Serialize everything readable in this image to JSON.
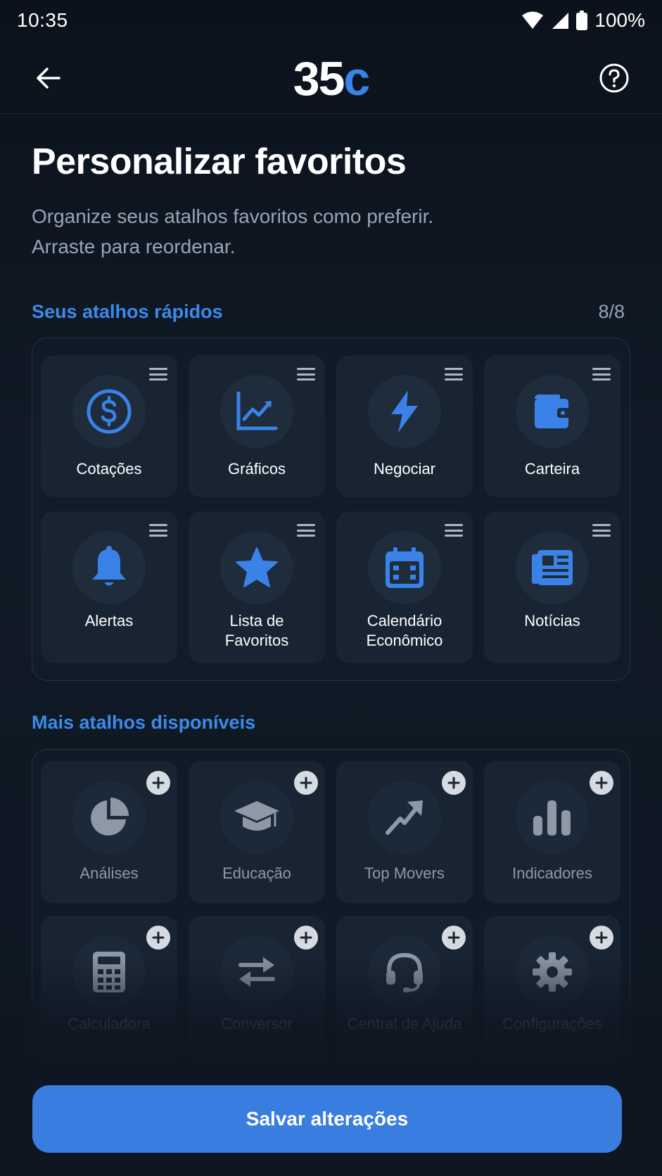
{
  "status_bar": {
    "time": "10:35",
    "battery": "100%"
  },
  "app_bar": {
    "logo_number": "35",
    "logo_letter": "c"
  },
  "page": {
    "title": "Personalizar favoritos",
    "subtitle_line1": "Organize seus atalhos favoritos como preferir.",
    "subtitle_line2": "Arraste para reordenar."
  },
  "quick": {
    "label": "Seus atalhos rápidos",
    "count": "8/8",
    "items": [
      {
        "label1": "Cotações",
        "label2": "",
        "icon": "dollar-icon"
      },
      {
        "label1": "Gráficos",
        "label2": "",
        "icon": "chart-line-icon"
      },
      {
        "label1": "Negociar",
        "label2": "",
        "icon": "lightning-icon"
      },
      {
        "label1": "Carteira",
        "label2": "",
        "icon": "wallet-icon"
      },
      {
        "label1": "Alertas",
        "label2": "",
        "icon": "bell-icon"
      },
      {
        "label1": "Lista de",
        "label2": "Favoritos",
        "icon": "star-icon"
      },
      {
        "label1": "Calendário",
        "label2": "Econômico",
        "icon": "calendar-icon"
      },
      {
        "label1": "Notícias",
        "label2": "",
        "icon": "newspaper-icon"
      }
    ]
  },
  "more": {
    "label": "Mais atalhos disponíveis",
    "items": [
      {
        "label": "Análises",
        "icon": "pie-chart-icon"
      },
      {
        "label": "Educação",
        "icon": "graduation-cap-icon"
      },
      {
        "label": "Top Movers",
        "icon": "trend-up-arrow-icon"
      },
      {
        "label": "Indicadores",
        "icon": "bar-chart-icon"
      },
      {
        "label": "Calculadora",
        "icon": "calculator-icon"
      },
      {
        "label": "Conversor",
        "icon": "swap-arrows-icon"
      },
      {
        "label": "Central de Ajuda",
        "icon": "headset-icon"
      },
      {
        "label": "Configurações",
        "icon": "gear-icon"
      }
    ]
  },
  "footer": {
    "save_label": "Salvar alterações"
  },
  "colors": {
    "accent": "#3b82e8",
    "background": "#0f1722",
    "tile": "#182432",
    "muted_text": "#9aa5b4"
  }
}
